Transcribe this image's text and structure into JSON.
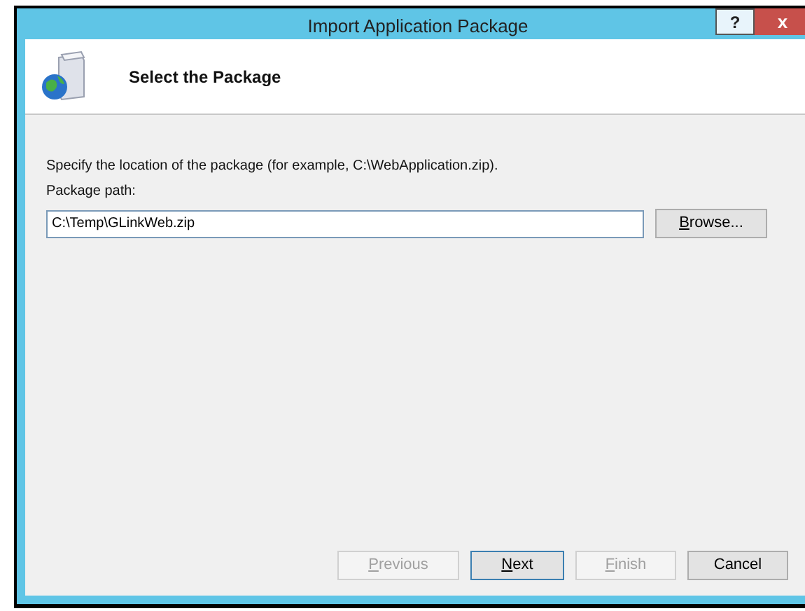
{
  "window": {
    "title": "Import Application Package",
    "title_buttons": [
      "?",
      "x"
    ]
  },
  "header": {
    "title": "Select the Package"
  },
  "instruction": "Specify the location of the package (for example, C:\\WebApplication.zip).",
  "path_field": {
    "label": "Package path:",
    "value": "C:\\Temp\\GLinkWeb.zip"
  },
  "browse_button": {
    "label": "Browse...",
    "disabled": false,
    "default": false
  },
  "buttons": [
    {
      "label": "Previous",
      "disabled": true,
      "default": false
    },
    {
      "label": "Next",
      "disabled": false,
      "default": true
    },
    {
      "label": "Finish",
      "disabled": true,
      "default": false
    },
    {
      "label": "Cancel",
      "disabled": false,
      "default": false
    }
  ]
}
